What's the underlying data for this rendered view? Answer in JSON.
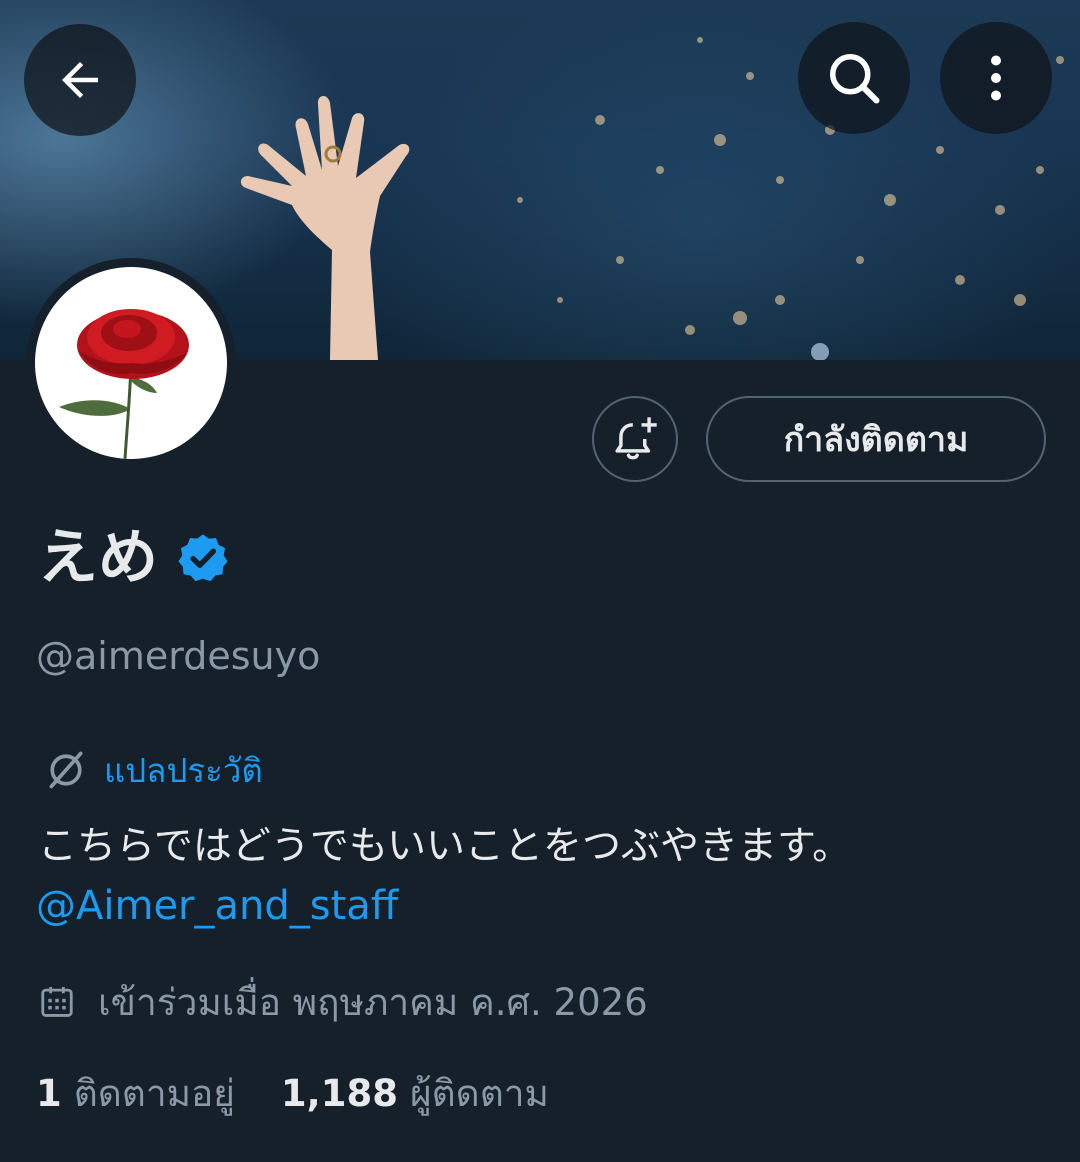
{
  "header": {
    "back_icon": "arrow-left-icon",
    "search_icon": "search-icon",
    "more_icon": "more-vertical-icon"
  },
  "profile": {
    "display_name": "えめ",
    "verified": true,
    "handle": "@aimerdesuyo",
    "avatar_icon": "red-rose-icon",
    "notify_icon": "bell-plus-icon",
    "following_label": "กำลังติดตาม",
    "translate_label": "แปลประวัติ",
    "translate_icon": "translate-globe-icon",
    "bio": "こちらではどうでもいいことをつぶやきます。",
    "bio_link": "@Aimer_and_staff",
    "joined_icon": "calendar-icon",
    "joined_text": "เข้าร่วมเมื่อ พฤษภาคม ค.ศ. 2026",
    "stats": {
      "following_count": "1",
      "following_label": "ติดตามอยู่",
      "followers_count": "1,188",
      "followers_label": "ผู้ติดตาม"
    }
  },
  "colors": {
    "background": "#15202b",
    "accent": "#1d9bf0",
    "text_primary": "#e7e9ea",
    "text_secondary": "#8b98a5",
    "border": "#536471"
  }
}
